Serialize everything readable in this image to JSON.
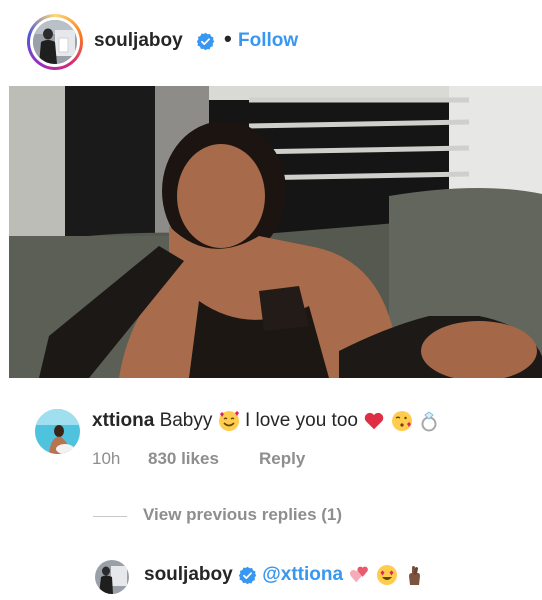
{
  "post": {
    "username": "souljaboy",
    "separator": "•",
    "follow_label": "Follow"
  },
  "comment": {
    "username": "xttiona",
    "text": "Babyy",
    "text2": "I love you too",
    "time": "10h",
    "likes": "830 likes",
    "reply_label": "Reply"
  },
  "view_replies_label": "View previous replies (1)",
  "reply": {
    "username": "souljaboy",
    "mention": "@xttiona"
  },
  "colors": {
    "link_blue": "#3897f0",
    "verified_blue": "#3897f0",
    "meta_gray": "#8e8e8e"
  }
}
